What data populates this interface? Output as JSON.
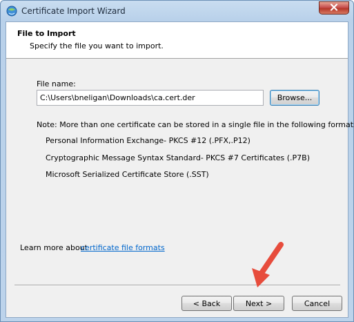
{
  "window": {
    "title": "Certificate Import Wizard"
  },
  "header": {
    "title": "File to Import",
    "subtitle": "Specify the file you want to import."
  },
  "file": {
    "label": "File name:",
    "value": "C:\\Users\\bneligan\\Downloads\\ca.cert.der",
    "browse_label": "Browse..."
  },
  "note": {
    "text": "Note:  More than one certificate can be stored in a single file in the following formats:",
    "formats": [
      "Personal Information Exchange- PKCS #12 (.PFX,.P12)",
      "Cryptographic Message Syntax Standard- PKCS #7 Certificates (.P7B)",
      "Microsoft Serialized Certificate Store (.SST)"
    ]
  },
  "learn_more": {
    "prefix": "Learn more about ",
    "link": "certificate file formats"
  },
  "footer": {
    "back_label": "< Back",
    "next_label": "Next >",
    "cancel_label": "Cancel"
  },
  "colors": {
    "accent_arrow": "#e74c3c",
    "link": "#0066cc"
  },
  "icons": {
    "app": "certificate-icon",
    "close": "close-icon"
  }
}
